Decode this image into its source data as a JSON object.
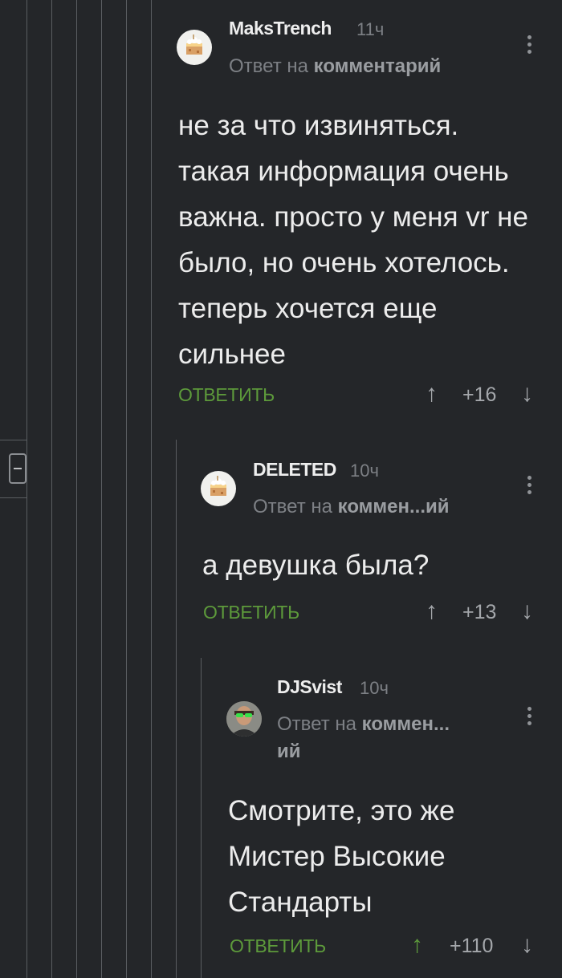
{
  "comments": [
    {
      "username": "MaksTrench",
      "time": "11ч",
      "reply_prefix": "Ответ на",
      "reply_target": "комментарий",
      "text": "не за что извиняться. такая информация очень важна.  просто у меня vr  не было, но очень хотелось. теперь хочется еще сильнее",
      "reply_label": "ОТВЕТИТЬ",
      "rating": "+16",
      "avatar": "cake-avatar"
    },
    {
      "username": "DELETED",
      "time": "10ч",
      "reply_prefix": "Ответ на",
      "reply_target": "коммен...ий",
      "text": "а девушка была?",
      "reply_label": "ОТВЕТИТЬ",
      "rating": "+13",
      "avatar": "cake-avatar"
    },
    {
      "username": "DJSvist",
      "time": "10ч",
      "reply_prefix": "Ответ на",
      "reply_target": "коммен...",
      "reply_target_cont": "ий",
      "text": "Смотрите, это же Мистер Высокие Стандарты",
      "reply_label": "ОТВЕТИТЬ",
      "rating": "+110",
      "avatar": "man-with-green-glasses-avatar"
    }
  ],
  "colors": {
    "background": "#242629",
    "accent_green": "#5d9a3b",
    "muted_text": "#7d8085"
  }
}
